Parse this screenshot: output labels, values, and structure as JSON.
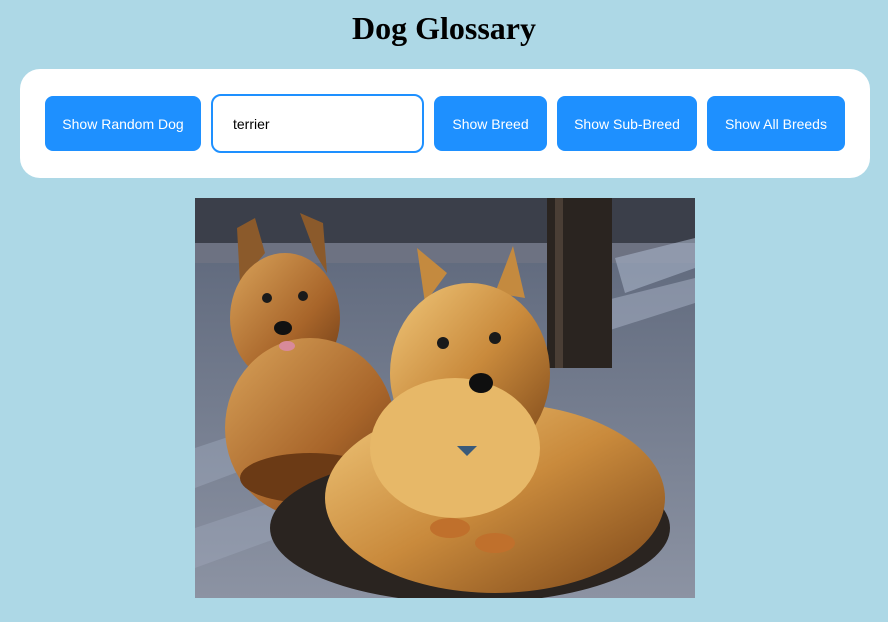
{
  "header": {
    "title": "Dog Glossary"
  },
  "toolbar": {
    "random_label": "Show Random Dog",
    "search_value": "terrier",
    "breed_label": "Show Breed",
    "sub_breed_label": "Show Sub-Breed",
    "all_breeds_label": "Show All Breeds"
  },
  "image": {
    "subject": "two terrier dogs sitting on pavement"
  },
  "colors": {
    "background": "#add8e6",
    "accent": "#1e90ff",
    "panel": "#ffffff"
  }
}
